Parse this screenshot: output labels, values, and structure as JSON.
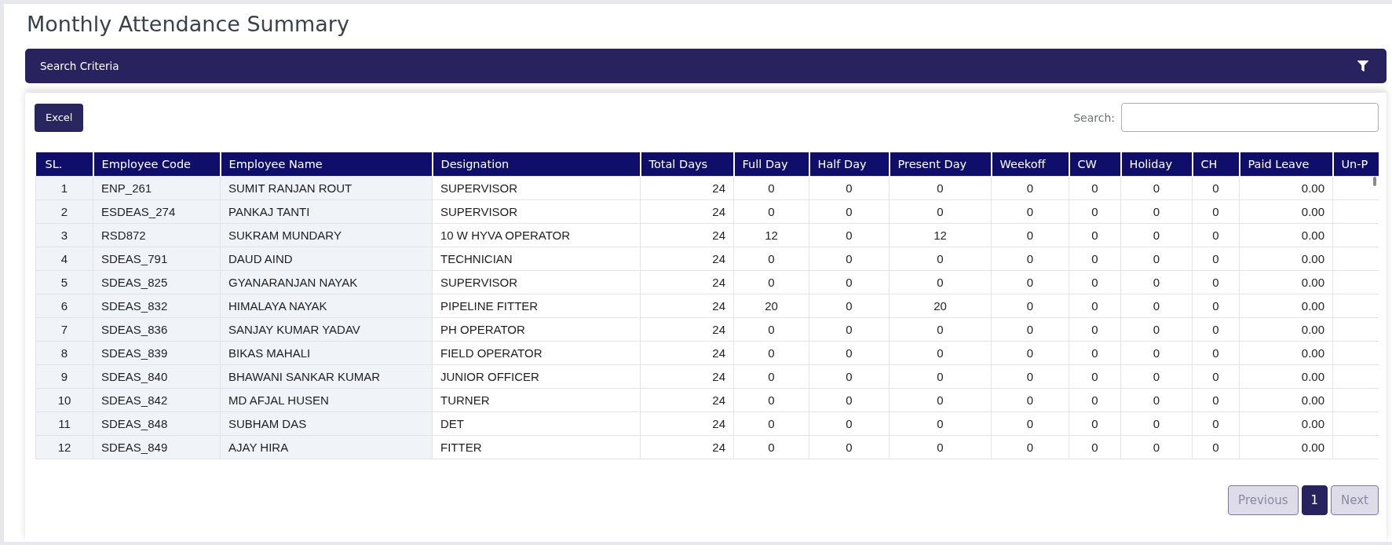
{
  "page": {
    "title": "Monthly Attendance Summary"
  },
  "search_criteria": {
    "title": "Search Criteria"
  },
  "toolbar": {
    "export_button": "Excel",
    "search": {
      "label": "Search:"
    }
  },
  "table": {
    "columns": [
      "SL.",
      "Employee Code",
      "Employee Name",
      "Designation",
      "Total Days",
      "Full Day",
      "Half Day",
      "Present Day",
      "Weekoff",
      "CW",
      "Holiday",
      "CH",
      "Paid Leave",
      "Un-P"
    ],
    "rows": [
      [
        "1",
        "ENP_261",
        "SUMIT RANJAN ROUT",
        "SUPERVISOR",
        "24",
        "0",
        "0",
        "0",
        "0",
        "0",
        "0",
        "0",
        "0.00"
      ],
      [
        "2",
        "ESDEAS_274",
        "PANKAJ TANTI",
        "SUPERVISOR",
        "24",
        "0",
        "0",
        "0",
        "0",
        "0",
        "0",
        "0",
        "0.00"
      ],
      [
        "3",
        "RSD872",
        "SUKRAM MUNDARY",
        "10 W HYVA OPERATOR",
        "24",
        "12",
        "0",
        "12",
        "0",
        "0",
        "0",
        "0",
        "0.00"
      ],
      [
        "4",
        "SDEAS_791",
        "DAUD AIND",
        "TECHNICIAN",
        "24",
        "0",
        "0",
        "0",
        "0",
        "0",
        "0",
        "0",
        "0.00"
      ],
      [
        "5",
        "SDEAS_825",
        "GYANARANJAN NAYAK",
        "SUPERVISOR",
        "24",
        "0",
        "0",
        "0",
        "0",
        "0",
        "0",
        "0",
        "0.00"
      ],
      [
        "6",
        "SDEAS_832",
        "HIMALAYA NAYAK",
        "PIPELINE FITTER",
        "24",
        "20",
        "0",
        "20",
        "0",
        "0",
        "0",
        "0",
        "0.00"
      ],
      [
        "7",
        "SDEAS_836",
        "SANJAY KUMAR YADAV",
        "PH OPERATOR",
        "24",
        "0",
        "0",
        "0",
        "0",
        "0",
        "0",
        "0",
        "0.00"
      ],
      [
        "8",
        "SDEAS_839",
        "BIKAS MAHALI",
        "FIELD OPERATOR",
        "24",
        "0",
        "0",
        "0",
        "0",
        "0",
        "0",
        "0",
        "0.00"
      ],
      [
        "9",
        "SDEAS_840",
        "BHAWANI SANKAR KUMAR",
        "JUNIOR OFFICER",
        "24",
        "0",
        "0",
        "0",
        "0",
        "0",
        "0",
        "0",
        "0.00"
      ],
      [
        "10",
        "SDEAS_842",
        "MD AFJAL HUSEN",
        "TURNER",
        "24",
        "0",
        "0",
        "0",
        "0",
        "0",
        "0",
        "0",
        "0.00"
      ],
      [
        "11",
        "SDEAS_848",
        "SUBHAM DAS",
        "DET",
        "24",
        "0",
        "0",
        "0",
        "0",
        "0",
        "0",
        "0",
        "0.00"
      ],
      [
        "12",
        "SDEAS_849",
        "AJAY HIRA",
        "FITTER",
        "24",
        "0",
        "0",
        "0",
        "0",
        "0",
        "0",
        "0",
        "0.00"
      ]
    ]
  },
  "pagination": {
    "previous": {
      "label": "Previous",
      "disabled": true
    },
    "pages": [
      {
        "label": "1",
        "selected": true
      }
    ],
    "next": {
      "label": "Next",
      "disabled": true
    }
  }
}
